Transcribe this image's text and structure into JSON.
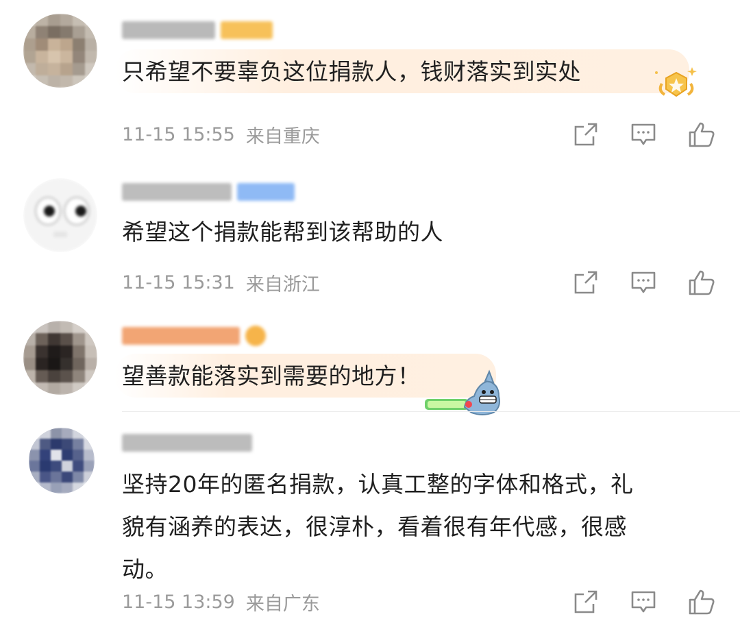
{
  "comments": [
    {
      "text": "只希望不要辜负这位捐款人，钱财落实到实处",
      "time": "11-15 15:55",
      "location": "来自重庆"
    },
    {
      "text": "希望这个捐款能帮到该帮助的人",
      "time": "11-15 15:31",
      "location": "来自浙江"
    },
    {
      "text": "望善款能落实到需要的地方！"
    },
    {
      "text": "坚持20年的匿名捐款，认真工整的字体和格式，礼\n貌有涵养的表达，很淳朴，看着很有年代感，很感\n动。",
      "time": "11-15 13:59",
      "location": "来自广东"
    }
  ],
  "icons": {
    "share": "share-icon",
    "reply": "comment-icon",
    "like": "like-icon"
  },
  "colors": {
    "text": "#1f1f1f",
    "meta": "#9a9a9a",
    "icon": "#8a8a8a",
    "vip_badge": "#f7b84b",
    "member_badge": "#5aa0ff"
  }
}
